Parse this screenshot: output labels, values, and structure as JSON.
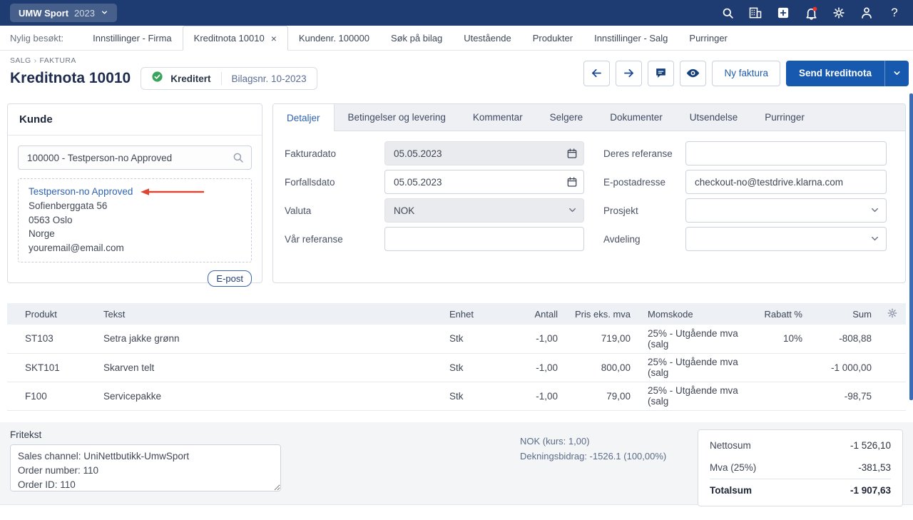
{
  "colors": {
    "topbar_bg": "#1f3c72",
    "primary_blue": "#1759ae",
    "link_blue": "#2f63b4",
    "status_green": "#3aa45c",
    "notification_red": "#e8352c",
    "annotation_red": "#dd4633",
    "title_navy": "#1e2b4e"
  },
  "topbar": {
    "company_name": "UMW Sport",
    "company_year": "2023",
    "icons": [
      "search",
      "company-register",
      "add",
      "notifications",
      "settings",
      "account",
      "help"
    ],
    "help_label": "?"
  },
  "history_bar": {
    "label": "Nylig besøkt:",
    "tabs": [
      {
        "label": "Innstillinger - Firma"
      },
      {
        "label": "Kreditnota 10010",
        "active": true,
        "closable": true
      },
      {
        "label": "Kundenr. 100000"
      },
      {
        "label": "Søk på bilag"
      },
      {
        "label": "Utestående"
      },
      {
        "label": "Produkter"
      },
      {
        "label": "Innstillinger - Salg"
      },
      {
        "label": "Purringer"
      }
    ]
  },
  "header": {
    "breadcrumb_section": "SALG",
    "breadcrumb_separator": "›",
    "breadcrumb_page": "FAKTURA",
    "title": "Kreditnota 10010",
    "status_label": "Kreditert",
    "voucher_label": "Bilagsnr. 10-2023",
    "new_invoice_label": "Ny faktura",
    "send_label": "Send kreditnota"
  },
  "customer_panel": {
    "title": "Kunde",
    "search_value": "100000 - Testperson-no Approved",
    "customer_name": "Testperson-no Approved",
    "address_lines": [
      "Sofienberggata 56",
      "0563 Oslo",
      "Norge",
      "youremail@email.com"
    ],
    "email_button_label": "E-post"
  },
  "details_panel": {
    "tabs": [
      {
        "label": "Detaljer",
        "active": true
      },
      {
        "label": "Betingelser og levering"
      },
      {
        "label": "Kommentar"
      },
      {
        "label": "Selgere"
      },
      {
        "label": "Dokumenter"
      },
      {
        "label": "Utsendelse"
      },
      {
        "label": "Purringer"
      }
    ],
    "fields": {
      "invoice_date": {
        "label": "Fakturadato",
        "value": "05.05.2023"
      },
      "due_date": {
        "label": "Forfallsdato",
        "value": "05.05.2023"
      },
      "currency": {
        "label": "Valuta",
        "value": "NOK"
      },
      "our_reference": {
        "label": "Vår referanse",
        "value": ""
      },
      "their_reference": {
        "label": "Deres referanse",
        "value": ""
      },
      "email_address": {
        "label": "E-postadresse",
        "value": "checkout-no@testdrive.klarna.com"
      },
      "project": {
        "label": "Prosjekt",
        "value": ""
      },
      "department": {
        "label": "Avdeling",
        "value": ""
      }
    }
  },
  "line_items": {
    "columns": [
      {
        "key": "product",
        "label": "Produkt",
        "align": "left"
      },
      {
        "key": "text",
        "label": "Tekst",
        "align": "left"
      },
      {
        "key": "unit",
        "label": "Enhet",
        "align": "left"
      },
      {
        "key": "quantity",
        "label": "Antall",
        "align": "right"
      },
      {
        "key": "price",
        "label": "Pris eks. mva",
        "align": "right"
      },
      {
        "key": "vat_code",
        "label": "Momskode",
        "align": "left"
      },
      {
        "key": "discount",
        "label": "Rabatt %",
        "align": "right"
      },
      {
        "key": "sum",
        "label": "Sum",
        "align": "right"
      }
    ],
    "rows": [
      {
        "product": "ST103",
        "text": "Setra jakke grønn",
        "unit": "Stk",
        "quantity": "-1,00",
        "price": "719,00",
        "vat_code": "25% - Utgående mva (salg",
        "discount": "10%",
        "sum": "-808,88"
      },
      {
        "product": "SKT101",
        "text": "Skarven telt",
        "unit": "Stk",
        "quantity": "-1,00",
        "price": "800,00",
        "vat_code": "25% - Utgående mva (salg",
        "discount": "",
        "sum": "-1 000,00"
      },
      {
        "product": "F100",
        "text": "Servicepakke",
        "unit": "Stk",
        "quantity": "-1,00",
        "price": "79,00",
        "vat_code": "25% - Utgående mva (salg",
        "discount": "",
        "sum": "-98,75"
      }
    ]
  },
  "bottom": {
    "free_text_label": "Fritekst",
    "free_text_value": "Sales channel: UniNettbutikk-UmwSport\nOrder number: 110\nOrder ID: 110",
    "currency_info": "NOK (kurs: 1,00)",
    "contribution_info": "Dekningsbidrag: -1526.1 (100,00%)",
    "totals": [
      {
        "label": "Nettosum",
        "value": "-1 526,10"
      },
      {
        "label": "Mva (25%)",
        "value": "-381,53"
      },
      {
        "label": "Totalsum",
        "value": "-1 907,63",
        "emphasis": true
      }
    ]
  }
}
